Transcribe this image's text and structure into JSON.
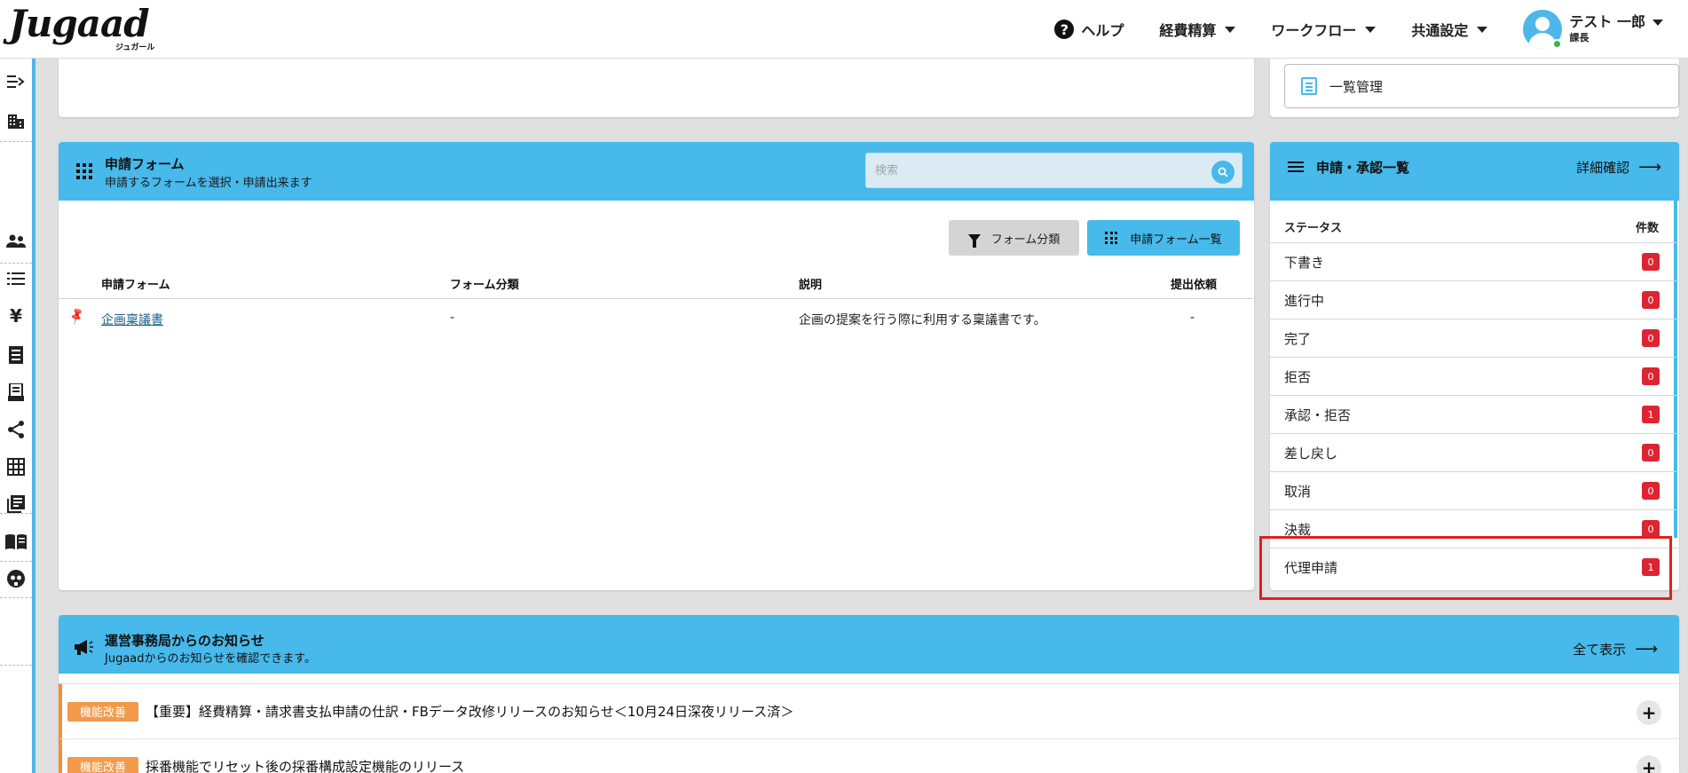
{
  "header": {
    "logo_text": "Jugaad",
    "logo_sub": "ジュガール",
    "help_label": "ヘルプ",
    "nav": [
      {
        "label": "経費精算"
      },
      {
        "label": "ワークフロー"
      },
      {
        "label": "共通設定"
      }
    ],
    "user": {
      "name": "テスト 一郎",
      "role": "課長"
    }
  },
  "top_cards": {
    "ichiran_label": "一覧管理"
  },
  "form_card": {
    "title": "申請フォーム",
    "subtitle": "申請するフォームを選択・申請出来ます",
    "search_placeholder": "検索",
    "filter_button": "フォーム分類",
    "list_button": "申請フォーム一覧",
    "columns": [
      "申請フォーム",
      "フォーム分類",
      "説明",
      "提出依頼"
    ],
    "rows": [
      {
        "name": "企画稟議書",
        "category": "-",
        "description": "企画の提案を行う際に利用する稟議書です。",
        "request": "-"
      }
    ]
  },
  "status_card": {
    "title": "申請・承認一覧",
    "more_label": "詳細確認",
    "col_status": "ステータス",
    "col_count": "件数",
    "rows": [
      {
        "label": "下書き",
        "count": "0"
      },
      {
        "label": "進行中",
        "count": "0"
      },
      {
        "label": "完了",
        "count": "0"
      },
      {
        "label": "拒否",
        "count": "0"
      },
      {
        "label": "承認・拒否",
        "count": "1"
      },
      {
        "label": "差し戻し",
        "count": "0"
      },
      {
        "label": "取消",
        "count": "0"
      },
      {
        "label": "決裁",
        "count": "0"
      },
      {
        "label": "代理申請",
        "count": "1"
      }
    ]
  },
  "news_card": {
    "title": "運営事務局からのお知らせ",
    "subtitle": "Jugaadからのお知らせを確認できます。",
    "more_label": "全て表示",
    "items": [
      {
        "tag": "機能改善",
        "text": "【重要】経費精算・請求書支払申請の仕訳・FBデータ改修リリースのお知らせ＜10月24日深夜リリース済＞"
      },
      {
        "tag": "機能改善",
        "text": "採番機能でリセット後の採番構成設定機能のリリース"
      }
    ]
  },
  "colors": {
    "accent": "#47b9ea",
    "badge": "#dc2533",
    "tag": "#f39a4a",
    "highlight": "#e02020"
  }
}
